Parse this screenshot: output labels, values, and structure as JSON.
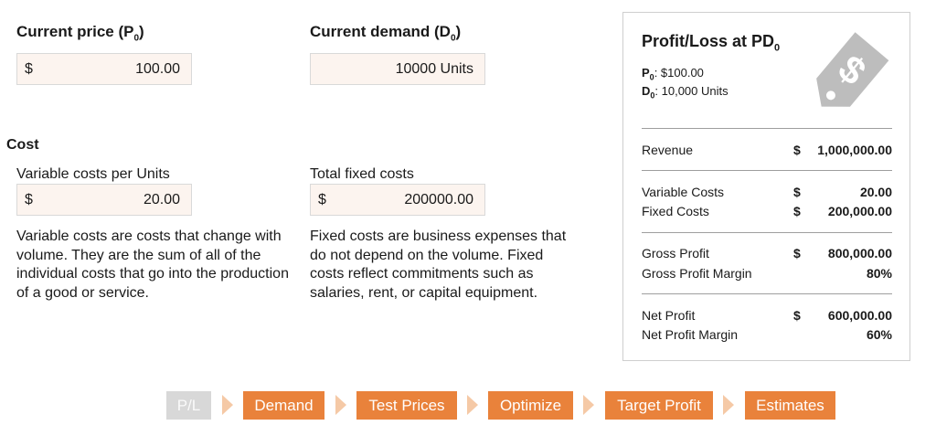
{
  "inputs": {
    "price": {
      "label": "Current price (P",
      "sub": "0",
      "close": ")",
      "currency": "$",
      "value": "100.00"
    },
    "demand": {
      "label": "Current demand (D",
      "sub": "0",
      "close": ")",
      "value": "10000 Units"
    }
  },
  "cost": {
    "heading": "Cost",
    "variable": {
      "label": "Variable costs per Units",
      "currency": "$",
      "value": "20.00",
      "description": "Variable costs are costs that change with volume. They are the sum of all of the individual costs that go into the production of a good or service."
    },
    "fixed": {
      "label": "Total fixed costs",
      "currency": "$",
      "value": "200000.00",
      "description": "Fixed costs are business expenses that do not depend on the volume. Fixed costs reflect commitments such as salaries, rent, or capital equipment."
    }
  },
  "panel": {
    "title": "Profit/Loss at PD",
    "title_sub": "0",
    "p0_label": "P",
    "p0_sub": "0",
    "p0_value": ": $100.00",
    "d0_label": "D",
    "d0_sub": "0",
    "d0_value": ": 10,000 Units",
    "icon": "price-tag-dollar-icon",
    "icon_color": "#bdbdbd",
    "rows": [
      {
        "label": "Revenue",
        "currency": "$",
        "value": "1,000,000.00"
      },
      {
        "label": "Variable Costs",
        "currency": "$",
        "value": "20.00"
      },
      {
        "label": "Fixed Costs",
        "currency": "$",
        "value": "200,000.00"
      },
      {
        "label": "Gross Profit",
        "currency": "$",
        "value": "800,000.00"
      },
      {
        "label": "Gross Profit Margin",
        "currency": "",
        "value": "80%"
      },
      {
        "label": "Net Profit",
        "currency": "$",
        "value": "600,000.00"
      },
      {
        "label": "Net Profit Margin",
        "currency": "",
        "value": "60%"
      }
    ]
  },
  "nav": {
    "accent": "#e9823b",
    "steps": [
      "P/L",
      "Demand",
      "Test Prices",
      "Optimize",
      "Target Profit",
      "Estimates"
    ]
  }
}
